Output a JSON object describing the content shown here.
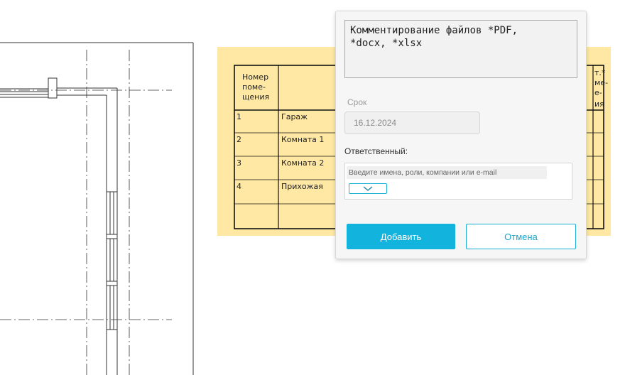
{
  "table": {
    "header_col1": [
      "Номер",
      "поме-",
      "щения"
    ],
    "header_right": [
      "т.*",
      "ме-",
      "е-",
      "ия"
    ],
    "rows": [
      {
        "num": "1",
        "name": "Гараж"
      },
      {
        "num": "2",
        "name": "Комната 1"
      },
      {
        "num": "3",
        "name": "Комната 2"
      },
      {
        "num": "4",
        "name": "Прихожая"
      }
    ]
  },
  "popup": {
    "comment_text": "Комментирование файлов *PDF,\n*docx, *xlsx",
    "due_label": "Срок",
    "due_value": "16.12.2024",
    "responsible_label": "Ответственный:",
    "responsible_placeholder": "Введите имена, роли, компании или e-mail",
    "dropdown_icon": "chevron-down-icon",
    "add_label": "Добавить",
    "cancel_label": "Отмена"
  },
  "colors": {
    "accent": "#12b3dd",
    "table_highlight": "#ffe8a3"
  }
}
